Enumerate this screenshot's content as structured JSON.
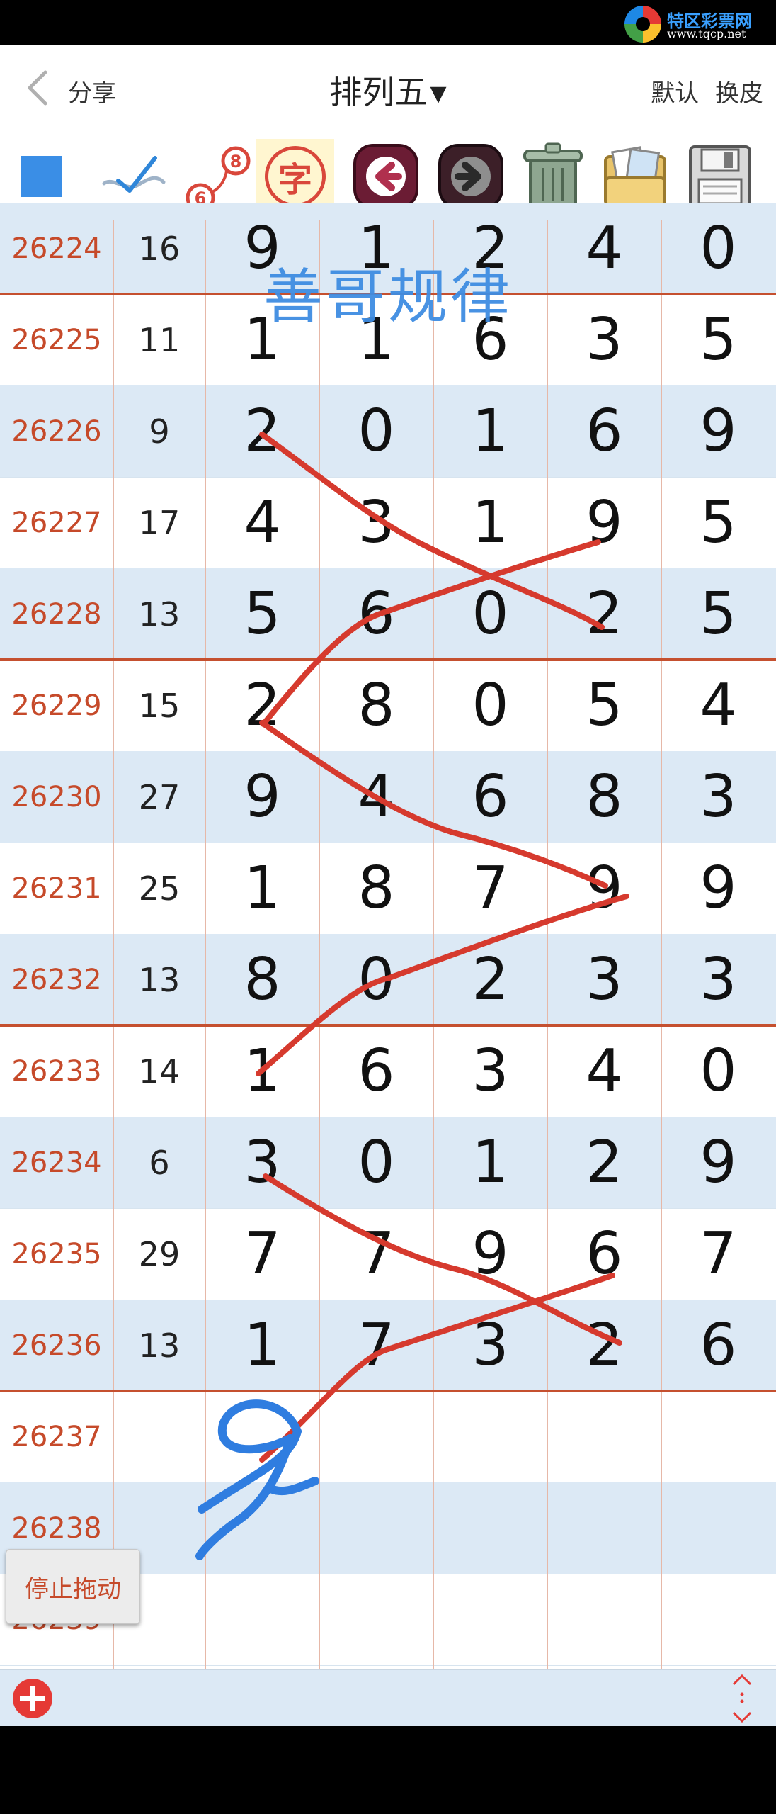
{
  "watermark": {
    "name": "特区彩票网",
    "url": "www.tqcp.net"
  },
  "header": {
    "share_label": "分享",
    "title": "排列五",
    "default_label": "默认",
    "skin_label": "换皮"
  },
  "toolbar": {
    "ball_top": "8",
    "ball_bottom": "6",
    "char_label": "字"
  },
  "overlay": {
    "caption": "善哥规律",
    "handwritten": "9"
  },
  "floating": {
    "stop_drag_label": "停止拖动"
  },
  "rows": [
    {
      "issue": "26224",
      "sum": "16",
      "d": [
        "9",
        "1",
        "2",
        "4",
        "0"
      ]
    },
    {
      "issue": "26225",
      "sum": "11",
      "d": [
        "1",
        "1",
        "6",
        "3",
        "5"
      ]
    },
    {
      "issue": "26226",
      "sum": "9",
      "d": [
        "2",
        "0",
        "1",
        "6",
        "9"
      ]
    },
    {
      "issue": "26227",
      "sum": "17",
      "d": [
        "4",
        "3",
        "1",
        "9",
        "5"
      ]
    },
    {
      "issue": "26228",
      "sum": "13",
      "d": [
        "5",
        "6",
        "0",
        "2",
        "5"
      ]
    },
    {
      "issue": "26229",
      "sum": "15",
      "d": [
        "2",
        "8",
        "0",
        "5",
        "4"
      ]
    },
    {
      "issue": "26230",
      "sum": "27",
      "d": [
        "9",
        "4",
        "6",
        "8",
        "3"
      ]
    },
    {
      "issue": "26231",
      "sum": "25",
      "d": [
        "1",
        "8",
        "7",
        "9",
        "9"
      ]
    },
    {
      "issue": "26232",
      "sum": "13",
      "d": [
        "8",
        "0",
        "2",
        "3",
        "3"
      ]
    },
    {
      "issue": "26233",
      "sum": "14",
      "d": [
        "1",
        "6",
        "3",
        "4",
        "0"
      ]
    },
    {
      "issue": "26234",
      "sum": "6",
      "d": [
        "3",
        "0",
        "1",
        "2",
        "9"
      ]
    },
    {
      "issue": "26235",
      "sum": "29",
      "d": [
        "7",
        "7",
        "9",
        "6",
        "7"
      ]
    },
    {
      "issue": "26236",
      "sum": "13",
      "d": [
        "1",
        "7",
        "3",
        "2",
        "6"
      ]
    },
    {
      "issue": "26237",
      "sum": "",
      "d": [
        "",
        "",
        "",
        "",
        ""
      ]
    },
    {
      "issue": "26238",
      "sum": "",
      "d": [
        "",
        "",
        "",
        "",
        ""
      ]
    },
    {
      "issue": "26239",
      "sum": "",
      "d": [
        "",
        "",
        "",
        "",
        ""
      ]
    }
  ]
}
